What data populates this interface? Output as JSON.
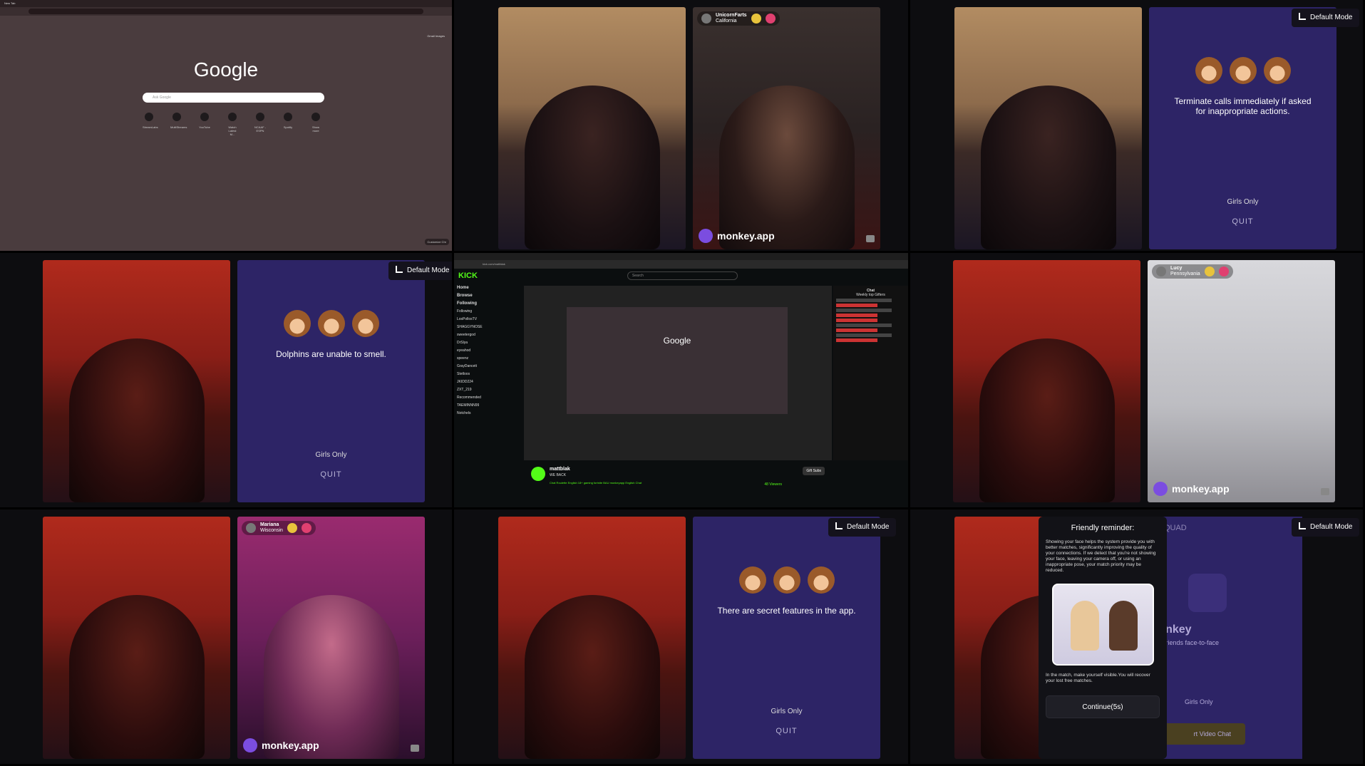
{
  "colors": {
    "panel": "#2d2466",
    "kick_green": "#53fc18",
    "modal": "#121217"
  },
  "browser": {
    "tab_title": "New Tab",
    "search_placeholder": "Ask Google",
    "logo": "Google",
    "top_links": "Gmail  Images",
    "shortcuts": [
      "StreamLabs",
      "MultiStreams",
      "YouTube",
      "Watch Latest M...",
      "NCAAF - ESPN",
      "Spotify",
      "Show more"
    ],
    "customize": "Customize Chr"
  },
  "cell2": {
    "username": "UnicornFarts",
    "location": "California",
    "badge": "monkey.app"
  },
  "panels": {
    "mode_label": "Default Mode",
    "girls_only": "Girls Only",
    "quit": "QUIT",
    "tips": [
      "Terminate calls immediately if asked for inappropriate actions.",
      "Dolphins are unable to smell.",
      "There are secret features in the app."
    ]
  },
  "kick": {
    "url": "kick.com/mattblak",
    "logo": "KICK",
    "search": "Search",
    "nav": [
      "Home",
      "Browse",
      "Following"
    ],
    "following_header": "Following",
    "following": [
      "LosPollosTV",
      "SHAGGYNOSE",
      "sweetergod",
      "DrSlya",
      "eyeahod",
      "speenz",
      "GrayDancett",
      "Stetloos",
      "JKIDD224",
      "ZXT_219"
    ],
    "recommended_header": "Recommended",
    "recommended": [
      "TAEMINNN99",
      "Notchels"
    ],
    "inner_logo": "Google",
    "chat_title": "Chat",
    "chat_sub": "Weekly top Gifters",
    "streamer": "mattblak",
    "status": "WE BACK",
    "tags": "Chat Roulette   English   18+   gaming   fortnite   BAU   monkeyapp   English   Chat",
    "gift": "Gift Subs",
    "viewers": "48 Viewers"
  },
  "cell6": {
    "username": "Lucy",
    "location": "Pennsylvania",
    "badge": "monkey.app"
  },
  "cell7": {
    "username": "Mariana",
    "location": "Wisconsin",
    "badge": "monkey.app"
  },
  "reminder": {
    "title": "Friendly reminder:",
    "body": "Showing your face helps the system provide you with better matches, significantly improving the quality of your connections. If we detect that you're not showing your face, leaving your camera off, or using an inappropriate pose, your match priority may be reduced.",
    "footer": "In the match, make yourself visible.You will recover your lost free matches.",
    "button": "Continue(5s)"
  },
  "behind": {
    "tabs": "SOLO  SQUAD",
    "title": "Monkey",
    "sub": "new friends face-to-face",
    "girls": "Girls Only",
    "start": "rt Video Chat",
    "mode": "Default Mode"
  }
}
